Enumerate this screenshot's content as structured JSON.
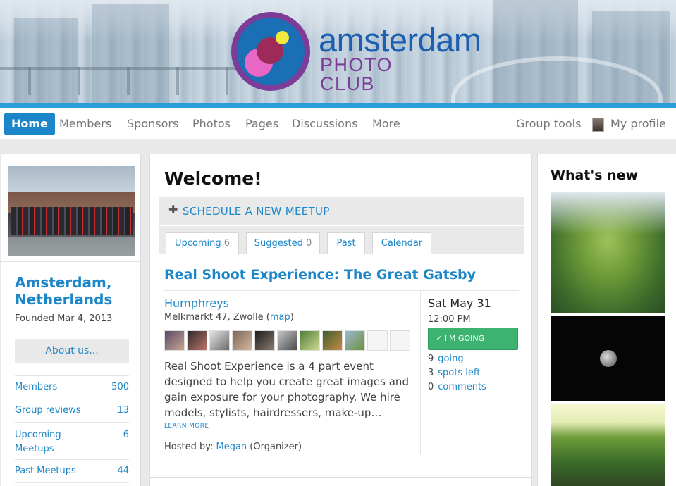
{
  "brand": {
    "logo_line1": "amsterdam",
    "logo_line2": "PHOTO CLUB",
    "colors": {
      "blue": "#1c5fb0",
      "purple": "#7d3c98",
      "accent": "#1b86c8",
      "stripe": "#2a9ed7",
      "going": "#3cb371"
    }
  },
  "nav": {
    "items": [
      "Home",
      "Members",
      "Sponsors",
      "Photos",
      "Pages",
      "Discussions",
      "More"
    ],
    "active": "Home",
    "group_tools": "Group tools",
    "my_profile": "My profile"
  },
  "sidebar": {
    "city": "Amsterdam, Netherlands",
    "founded": "Founded Mar 4, 2013",
    "about_button": "About us...",
    "stats": [
      {
        "label": "Members",
        "value": "500"
      },
      {
        "label": "Group reviews",
        "value": "13"
      },
      {
        "label": "Upcoming Meetups",
        "value": "6"
      },
      {
        "label": "Past Meetups",
        "value": "44"
      }
    ]
  },
  "main": {
    "welcome": "Welcome!",
    "schedule_icon": "plus-icon",
    "schedule_label": "SCHEDULE A NEW MEETUP",
    "tabs": [
      {
        "label": "Upcoming",
        "count": "6"
      },
      {
        "label": "Suggested",
        "count": "0"
      },
      {
        "label": "Past",
        "count": ""
      },
      {
        "label": "Calendar",
        "count": ""
      }
    ],
    "event": {
      "title": "Real Shoot Experience: The Great Gatsby",
      "venue": "Humphreys",
      "address": "Melkmarkt 47, Zwolle (",
      "map_link": "map",
      "address_close": ")",
      "description": "Real Shoot Experience is a 4 part event designed to help you create great images and gain exposure for your photography. We hire models, stylists, hairdressers, make-up…",
      "learn_more": "LEARN MORE",
      "hosted_prefix": "Hosted by: ",
      "host": "Megan",
      "host_role": " (Organizer)",
      "date": "Sat May 31",
      "time": "12:00 PM",
      "going_button": "✓ I'M GOING",
      "rsvp": [
        {
          "count": "9",
          "label": "going"
        },
        {
          "count": "3",
          "label": "spots left"
        },
        {
          "count": "0",
          "label": "comments"
        }
      ]
    }
  },
  "right": {
    "title": "What's new"
  }
}
